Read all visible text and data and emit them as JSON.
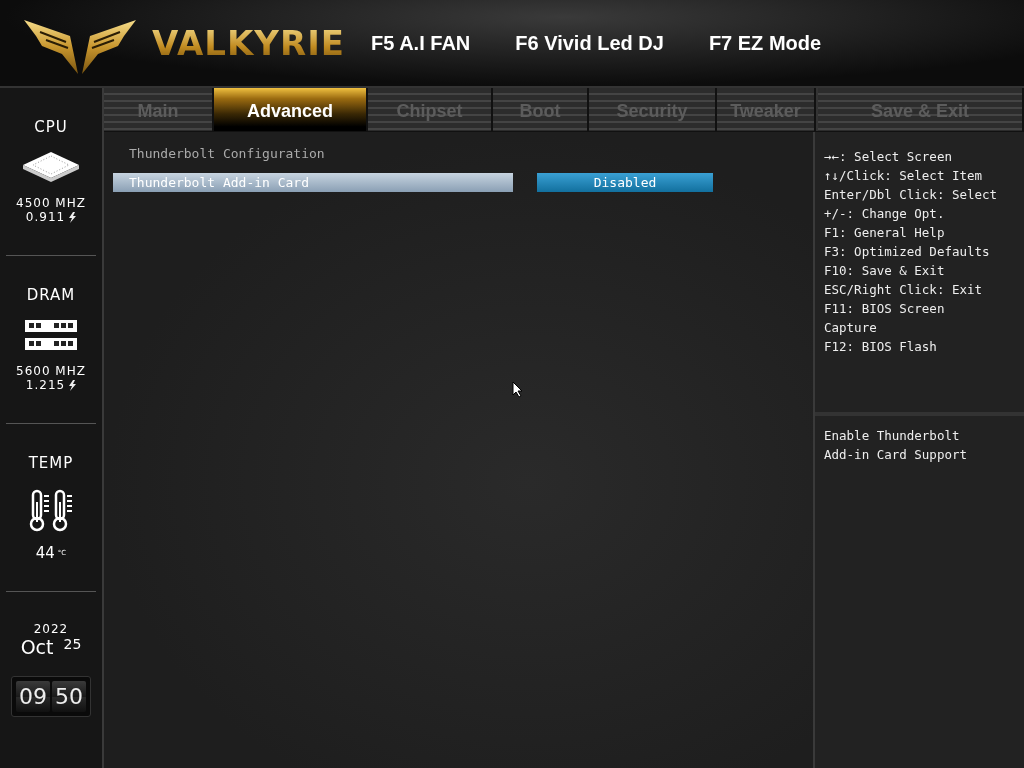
{
  "header": {
    "brand": "VALKYRIE",
    "hotkeys": [
      "F5 A.I FAN",
      "F6 Vivid Led DJ",
      "F7 EZ Mode"
    ]
  },
  "sidebar": {
    "cpu": {
      "label": "CPU",
      "frequency": "4500 MHZ",
      "voltage": "0.911"
    },
    "dram": {
      "label": "DRAM",
      "frequency": "5600 MHZ",
      "voltage": "1.215"
    },
    "temp": {
      "label": "TEMP",
      "value": "44",
      "unit": "°C"
    },
    "date": {
      "year": "2022",
      "month": "Oct",
      "day": "25"
    },
    "clock": {
      "hours": "09",
      "minutes": "50"
    }
  },
  "tabs": [
    {
      "label": "Main",
      "selected": false
    },
    {
      "label": "Advanced",
      "selected": true
    },
    {
      "label": "Chipset",
      "selected": false
    },
    {
      "label": "Boot",
      "selected": false
    },
    {
      "label": "Security",
      "selected": false
    },
    {
      "label": "Tweaker",
      "selected": false
    },
    {
      "label": "Save & Exit",
      "selected": false
    }
  ],
  "page": {
    "title": "Thunderbolt Configuration",
    "settings": [
      {
        "label": "Thunderbolt Add-in Card",
        "value": "Disabled",
        "selected": true
      }
    ]
  },
  "help": {
    "keys": [
      "→←: Select Screen",
      "↑↓/Click: Select Item",
      "Enter/Dbl Click: Select",
      "+/-: Change Opt.",
      "F1: General Help",
      "F3: Optimized Defaults",
      "F10: Save & Exit",
      "ESC/Right Click: Exit",
      "F11: BIOS Screen Capture",
      "F12: BIOS Flash"
    ],
    "description": "Enable Thunderbolt Add-in Card Support"
  }
}
